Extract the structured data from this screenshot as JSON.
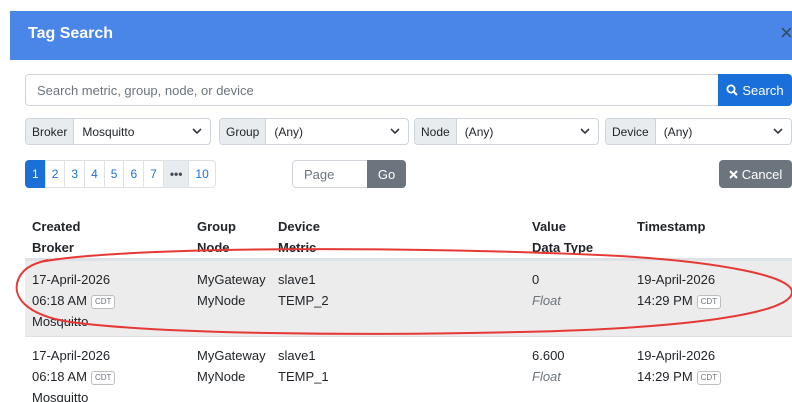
{
  "modal": {
    "title": "Tag Search",
    "close_symbol": "×"
  },
  "search": {
    "placeholder": "Search metric, group, node, or device",
    "button_label": "Search"
  },
  "filters": [
    {
      "label": "Broker",
      "value": "Mosquitto"
    },
    {
      "label": "Group",
      "value": "(Any)"
    },
    {
      "label": "Node",
      "value": "(Any)"
    },
    {
      "label": "Device",
      "value": "(Any)"
    }
  ],
  "pagination": {
    "pages": [
      "1",
      "2",
      "3",
      "4",
      "5",
      "6",
      "7"
    ],
    "ellipsis": "•••",
    "last": "10",
    "current": "1",
    "page_placeholder": "Page",
    "go_label": "Go"
  },
  "cancel_label": "Cancel",
  "table": {
    "headers": [
      [
        "Created",
        "Broker"
      ],
      [
        "Group",
        "Node"
      ],
      [
        "Device",
        "Metric"
      ],
      [
        "Value",
        "Data Type"
      ],
      [
        "Timestamp",
        ""
      ]
    ],
    "rows": [
      {
        "created_date": "17-April-2026",
        "created_time": "06:18 AM",
        "created_tz": "CDT",
        "broker": "Mosquitto",
        "group": "MyGateway",
        "node": "MyNode",
        "device": "slave1",
        "metric": "TEMP_2",
        "value": "0",
        "data_type": "Float",
        "ts_date": "19-April-2026",
        "ts_time": "14:29 PM",
        "ts_tz": "CDT",
        "highlighted": true
      },
      {
        "created_date": "17-April-2026",
        "created_time": "06:18 AM",
        "created_tz": "CDT",
        "broker": "Mosquitto",
        "group": "MyGateway",
        "node": "MyNode",
        "device": "slave1",
        "metric": "TEMP_1",
        "value": "6.600",
        "data_type": "Float",
        "ts_date": "19-April-2026",
        "ts_time": "14:29 PM",
        "ts_tz": "CDT",
        "highlighted": false
      }
    ]
  },
  "colors": {
    "header": "#4a86e8",
    "primary": "#1b6fd8",
    "secondary": "#6c757d",
    "annotation": "#e53935"
  }
}
